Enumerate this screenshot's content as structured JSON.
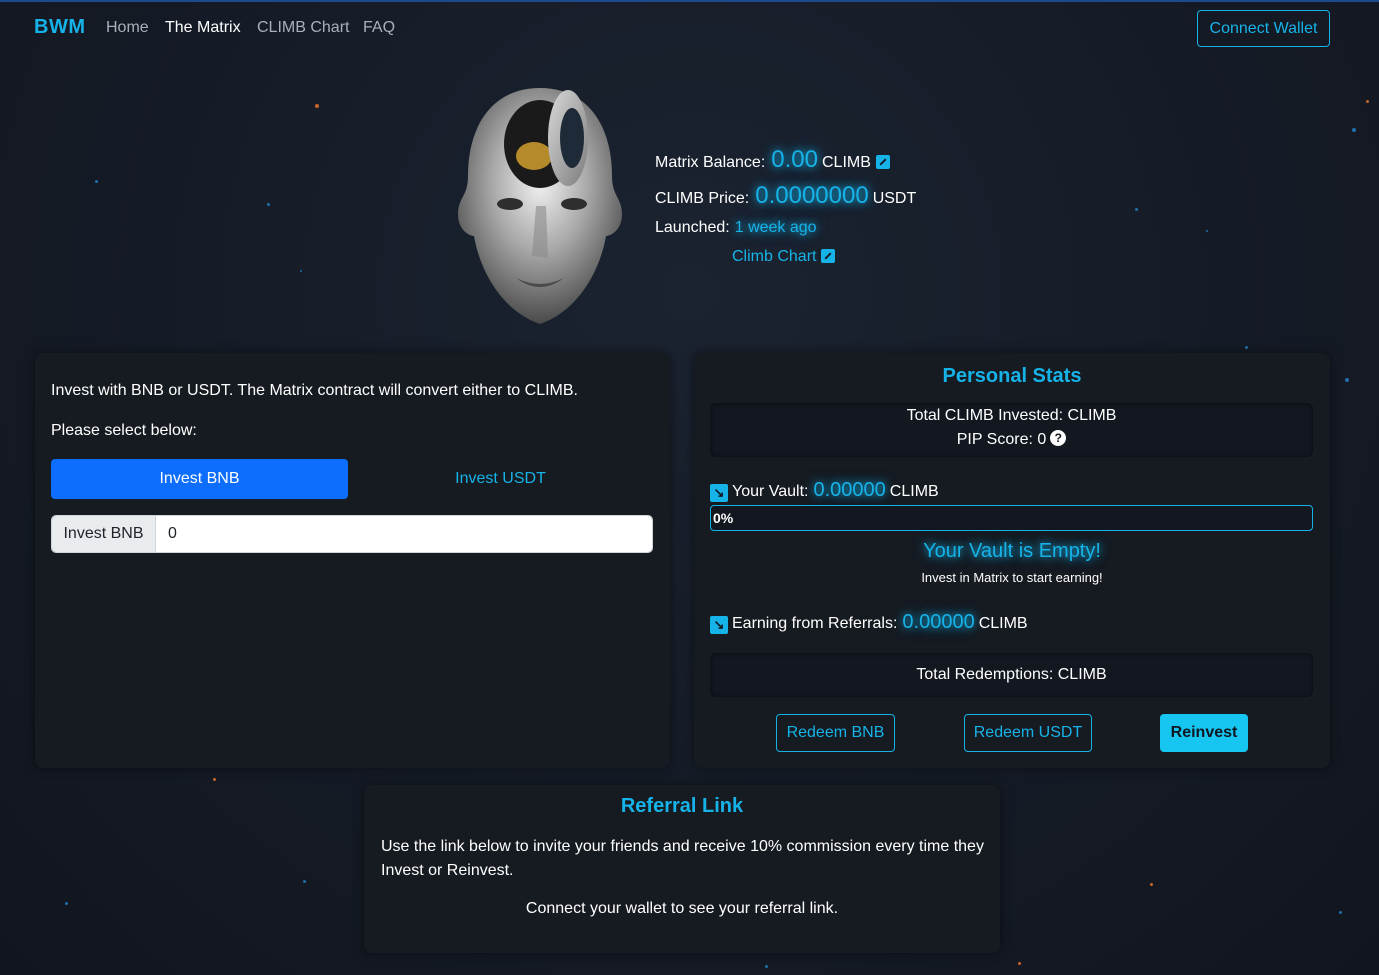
{
  "nav": {
    "brand": "BWM",
    "links": [
      {
        "label": "Home"
      },
      {
        "label": "The Matrix"
      },
      {
        "label": "CLIMB Chart"
      },
      {
        "label": "FAQ"
      }
    ],
    "connect_wallet": "Connect Wallet"
  },
  "hero": {
    "matrix_balance_label": "Matrix Balance:",
    "matrix_balance_value": "0.00",
    "matrix_balance_unit": "CLIMB",
    "climb_price_label": "CLIMB Price:",
    "climb_price_value": "0.0000000",
    "climb_price_unit": "USDT",
    "launched_label": "Launched:",
    "launched_value": "1 week ago",
    "climb_chart_link": "Climb Chart"
  },
  "invest": {
    "intro": "Invest with BNB or USDT. The Matrix contract will convert either to CLIMB.",
    "select_prompt": "Please select below:",
    "tab_bnb": "Invest BNB",
    "tab_usdt": "Invest USDT",
    "input_label": "Invest BNB",
    "input_value": "0"
  },
  "stats": {
    "title": "Personal Stats",
    "total_invested": "Total CLIMB Invested: CLIMB",
    "pip_score": "PIP Score: 0",
    "vault_label": "Your Vault:",
    "vault_value": "0.00000",
    "vault_unit": "CLIMB",
    "vault_progress": 0,
    "vault_progress_label": "0%",
    "empty_title": "Your Vault is Empty!",
    "empty_sub": "Invest in Matrix to start earning!",
    "referrals_label": "Earning from Referrals:",
    "referrals_value": "0.00000",
    "referrals_unit": "CLIMB",
    "total_redemptions": "Total Redemptions: CLIMB",
    "redeem_bnb": "Redeem BNB",
    "redeem_usdt": "Redeem USDT",
    "reinvest": "Reinvest"
  },
  "referral": {
    "title": "Referral Link",
    "description": "Use the link below to invite your friends and receive 10% commission every time they Invest or Reinvest.",
    "connect_prompt": "Connect your wallet to see your referral link."
  },
  "colors": {
    "accent": "#16b3e8",
    "primary_button": "#0d6efd",
    "background": "#151b26",
    "panel": "#161a21"
  }
}
